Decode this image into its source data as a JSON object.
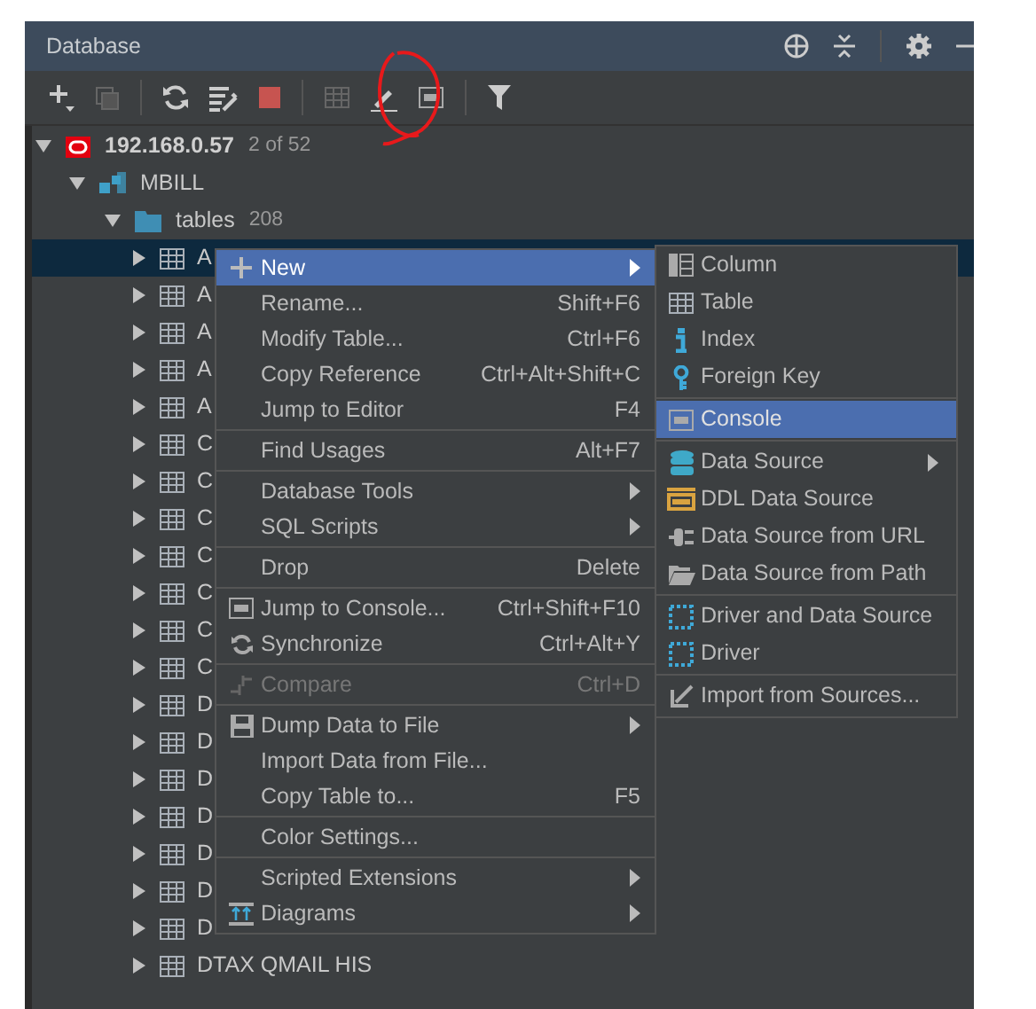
{
  "panel": {
    "title": "Database"
  },
  "tree": {
    "label": "192.168.0.57",
    "count": "2 of 52",
    "expanded": true,
    "children": [
      {
        "label": "MBILL",
        "expanded": true,
        "children": [
          {
            "label": "tables",
            "count": "208",
            "expanded": true,
            "children": [
              {
                "label": "A",
                "expanded": false,
                "selected": true
              },
              {
                "label": "A",
                "expanded": false,
                "selected": false
              },
              {
                "label": "A",
                "expanded": false,
                "selected": false
              },
              {
                "label": "A",
                "expanded": false,
                "selected": false
              },
              {
                "label": "A",
                "expanded": false,
                "selected": false
              },
              {
                "label": "C",
                "expanded": false,
                "selected": false
              },
              {
                "label": "C",
                "expanded": false,
                "selected": false
              },
              {
                "label": "C",
                "expanded": false,
                "selected": false
              },
              {
                "label": "C",
                "expanded": false,
                "selected": false
              },
              {
                "label": "C",
                "expanded": false,
                "selected": false
              },
              {
                "label": "C",
                "expanded": false,
                "selected": false
              },
              {
                "label": "C",
                "expanded": false,
                "selected": false
              },
              {
                "label": "D",
                "expanded": false,
                "selected": false
              },
              {
                "label": "D",
                "expanded": false,
                "selected": false
              },
              {
                "label": "D",
                "expanded": false,
                "selected": false
              },
              {
                "label": "D",
                "expanded": false,
                "selected": false
              },
              {
                "label": "D",
                "expanded": false,
                "selected": false
              },
              {
                "label": "D",
                "expanded": false,
                "selected": false
              },
              {
                "label": "D",
                "expanded": false,
                "selected": false
              },
              {
                "label": "DTAX QMAIL HIS",
                "expanded": false,
                "selected": false
              }
            ]
          }
        ]
      }
    ]
  },
  "context_menu": {
    "groups": [
      [
        {
          "label": "New",
          "submenu": true,
          "disabled": false,
          "selected": true
        },
        {
          "label": "Rename...",
          "shortcut": "Shift+F6",
          "submenu": false,
          "disabled": false,
          "selected": false
        },
        {
          "label": "Modify Table...",
          "shortcut": "Ctrl+F6",
          "submenu": false,
          "disabled": false,
          "selected": false
        },
        {
          "label": "Copy Reference",
          "shortcut": "Ctrl+Alt+Shift+C",
          "submenu": false,
          "disabled": false,
          "selected": false
        },
        {
          "label": "Jump to Editor",
          "shortcut": "F4",
          "submenu": false,
          "disabled": false,
          "selected": false
        }
      ],
      [
        {
          "label": "Find Usages",
          "shortcut": "Alt+F7",
          "submenu": false,
          "disabled": false,
          "selected": false
        }
      ],
      [
        {
          "label": "Database Tools",
          "submenu": true,
          "disabled": false,
          "selected": false
        },
        {
          "label": "SQL Scripts",
          "submenu": true,
          "disabled": false,
          "selected": false
        }
      ],
      [
        {
          "label": "Drop",
          "shortcut": "Delete",
          "submenu": false,
          "disabled": false,
          "selected": false
        }
      ],
      [
        {
          "label": "Jump to Console...",
          "shortcut": "Ctrl+Shift+F10",
          "submenu": false,
          "disabled": false,
          "selected": false
        },
        {
          "label": "Synchronize",
          "shortcut": "Ctrl+Alt+Y",
          "submenu": false,
          "disabled": false,
          "selected": false
        }
      ],
      [
        {
          "label": "Compare",
          "shortcut": "Ctrl+D",
          "submenu": false,
          "disabled": true,
          "selected": false
        }
      ],
      [
        {
          "label": "Dump Data to File",
          "submenu": true,
          "disabled": false,
          "selected": false
        },
        {
          "label": "Import Data from File...",
          "submenu": false,
          "disabled": false,
          "selected": false
        },
        {
          "label": "Copy Table to...",
          "shortcut": "F5",
          "submenu": false,
          "disabled": false,
          "selected": false
        }
      ],
      [
        {
          "label": "Color Settings...",
          "submenu": false,
          "disabled": false,
          "selected": false
        }
      ],
      [
        {
          "label": "Scripted Extensions",
          "submenu": true,
          "disabled": false,
          "selected": false
        },
        {
          "label": "Diagrams",
          "submenu": true,
          "disabled": false,
          "selected": false
        }
      ]
    ]
  },
  "new_submenu": {
    "groups": [
      [
        {
          "label": "Column",
          "submenu": false,
          "selected": false
        },
        {
          "label": "Table",
          "submenu": false,
          "selected": false
        },
        {
          "label": "Index",
          "submenu": false,
          "selected": false
        },
        {
          "label": "Foreign Key",
          "submenu": false,
          "selected": false
        }
      ],
      [
        {
          "label": "Console",
          "submenu": false,
          "selected": true
        }
      ],
      [
        {
          "label": "Data Source",
          "submenu": true,
          "selected": false
        },
        {
          "label": "DDL Data Source",
          "submenu": false,
          "selected": false
        },
        {
          "label": "Data Source from URL",
          "submenu": false,
          "selected": false
        },
        {
          "label": "Data Source from Path",
          "submenu": false,
          "selected": false
        }
      ],
      [
        {
          "label": "Driver and Data Source",
          "submenu": false,
          "selected": false
        },
        {
          "label": "Driver",
          "submenu": false,
          "selected": false
        }
      ],
      [
        {
          "label": "Import from Sources...",
          "submenu": false,
          "selected": false
        }
      ]
    ]
  }
}
